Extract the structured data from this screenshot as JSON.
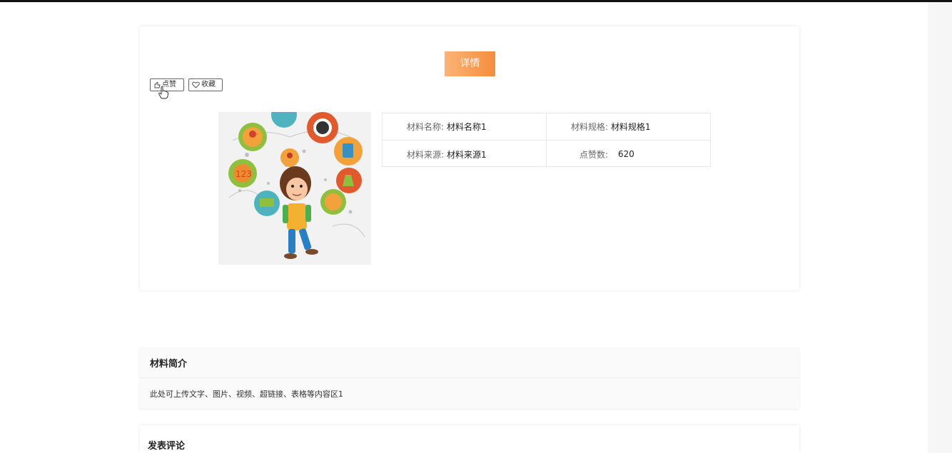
{
  "header": {
    "title": "详情"
  },
  "actions": {
    "like_label": "点赞",
    "favorite_label": "收藏"
  },
  "material": {
    "name_label": "材料名称:",
    "name_value": "材料名称1",
    "spec_label": "材料规格:",
    "spec_value": "材料规格1",
    "source_label": "材料来源:",
    "source_value": "材料来源1",
    "likes_label": "点赞数:",
    "likes_value": "620"
  },
  "intro": {
    "title": "材料简介",
    "content": "此处可上传文字、图片、视频、超链接、表格等内容区1"
  },
  "comments": {
    "title": "发表评论"
  },
  "colors": {
    "accent_start": "#fbb476",
    "accent_end": "#f58d3c"
  }
}
